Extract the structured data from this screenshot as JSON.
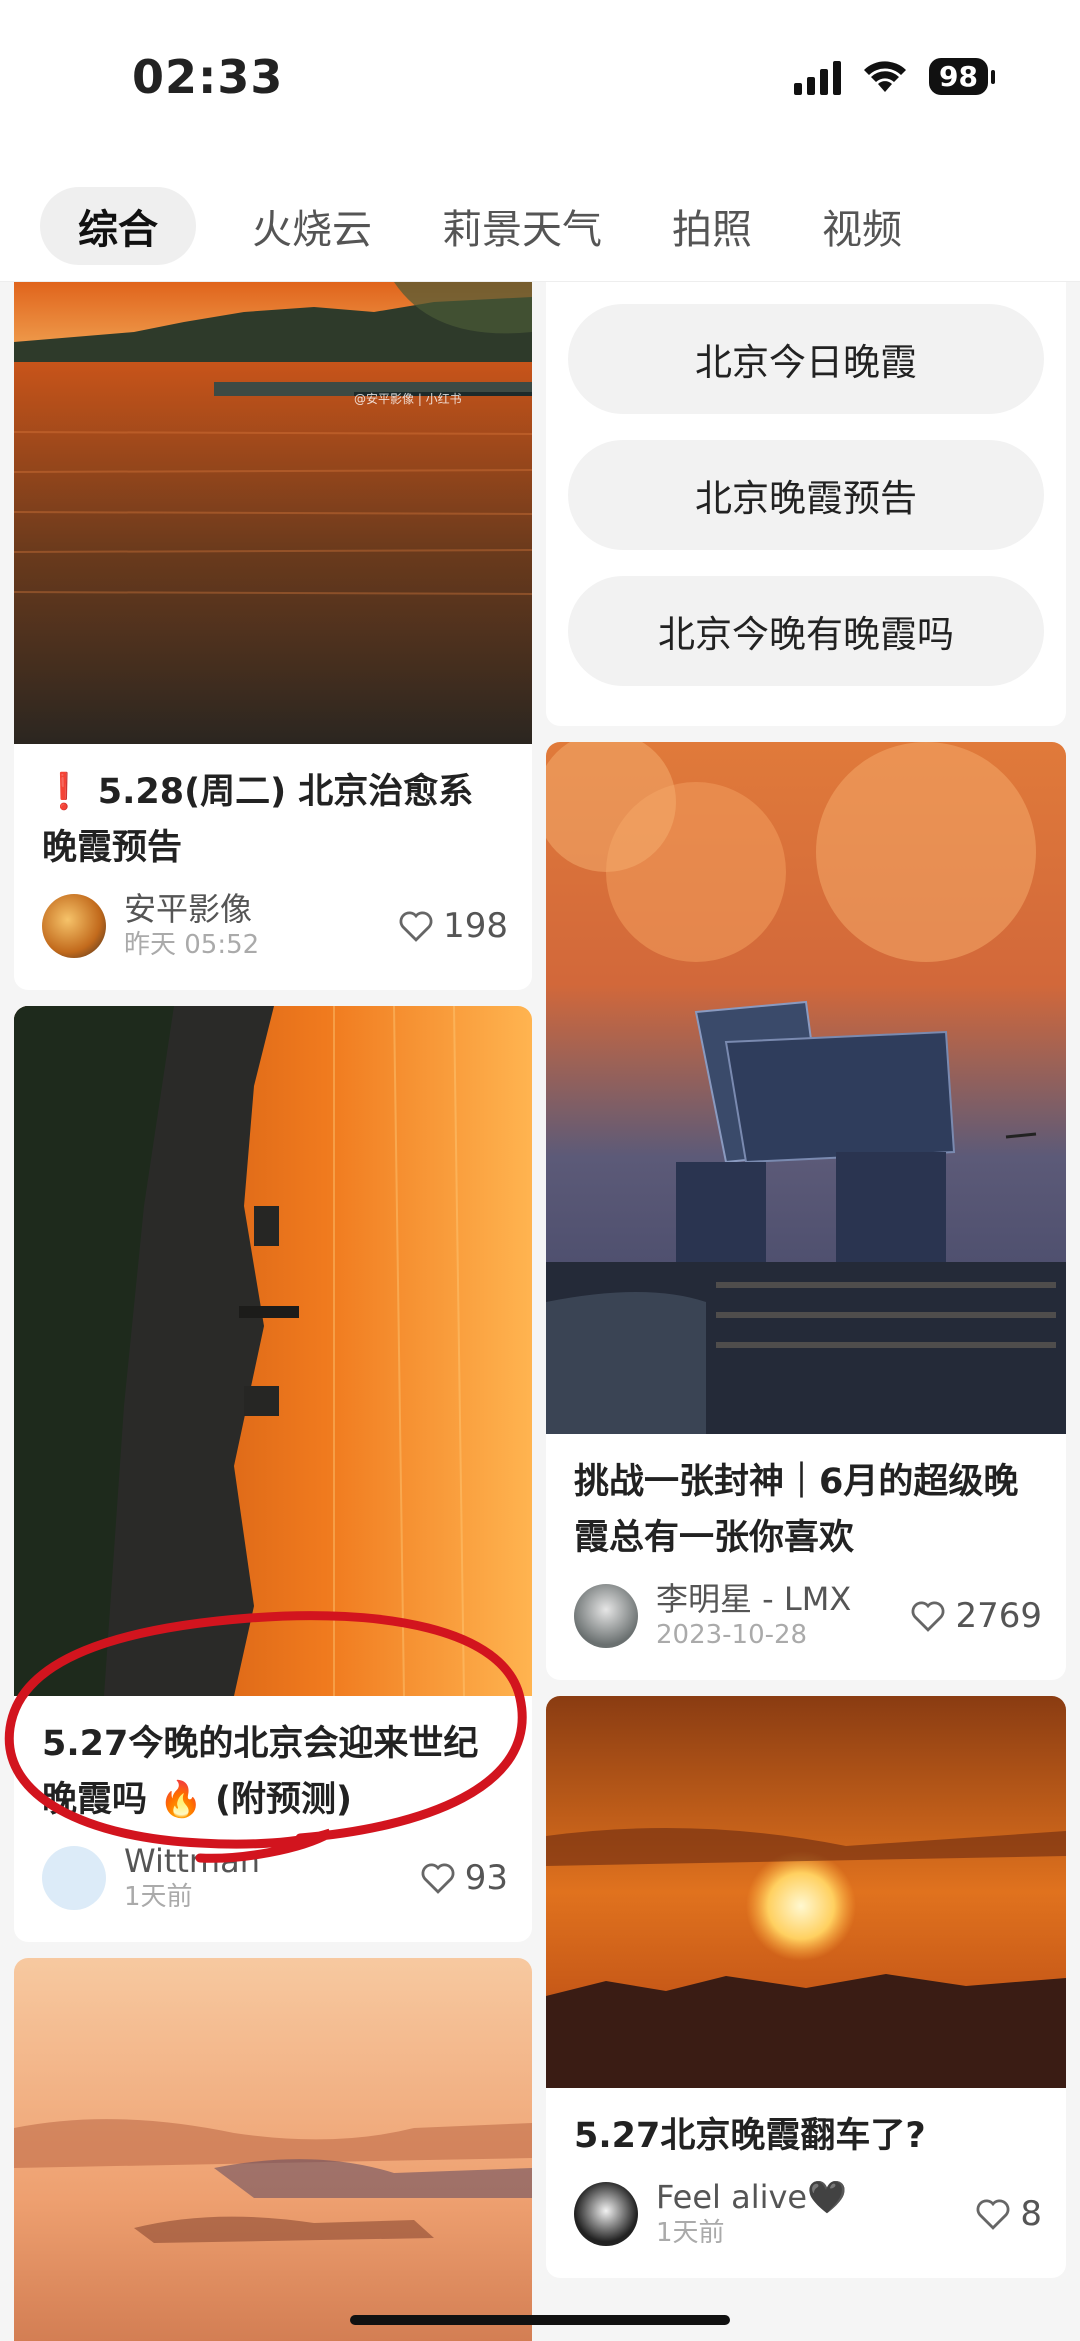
{
  "status": {
    "time": "02:33",
    "battery": "98"
  },
  "tabs": [
    "综合",
    "火烧云",
    "莉景天气",
    "拍照",
    "视频"
  ],
  "left": {
    "card1": {
      "watermark": "@安平影像 | 小红书",
      "title": "❗ 5.28(周二) 北京治愈系晚霞预告",
      "author": "安平影像",
      "time": "昨天 05:52",
      "likes": "198"
    },
    "card2": {
      "title": "5.27今晚的北京会迎来世纪晚霞吗 🔥 (附预测)",
      "author": "Wittman",
      "time": "1天前",
      "likes": "93"
    }
  },
  "right": {
    "suggestions": [
      "北京今日晚霞",
      "北京晚霞预告",
      "北京今晚有晚霞吗"
    ],
    "card1": {
      "title": "挑战一张封神｜6月的超级晚霞总有一张你喜欢",
      "author": "李明星 - LMX",
      "time": "2023-10-28",
      "likes": "2769"
    },
    "card2": {
      "title": "5.27北京晚霞翻车了?",
      "author": "Feel alive🖤",
      "time": "1天前",
      "likes": "8"
    }
  },
  "colors": {
    "accent_red": "#d2141e",
    "heart": "#666666"
  }
}
